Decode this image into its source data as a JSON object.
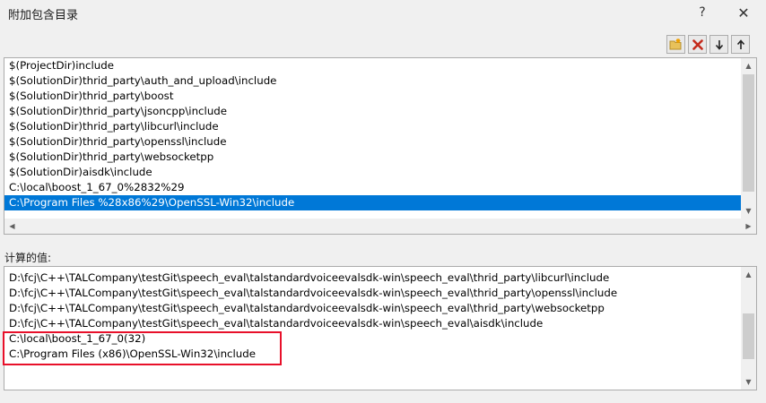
{
  "dialog": {
    "title": "附加包含目录",
    "help_symbol": "?",
    "close_symbol": "✕"
  },
  "toolbar": {
    "new_line_icon": "folder-new-icon",
    "delete_icon": "delete-icon",
    "move_down_icon": "arrow-down-icon",
    "move_up_icon": "arrow-up-icon",
    "delete_color": "#c42b1c"
  },
  "directories": {
    "items": [
      "$(ProjectDir)include",
      "$(SolutionDir)thrid_party\\auth_and_upload\\include",
      "$(SolutionDir)thrid_party\\boost",
      "$(SolutionDir)thrid_party\\jsoncpp\\include",
      "$(SolutionDir)thrid_party\\libcurl\\include",
      "$(SolutionDir)thrid_party\\openssl\\include",
      "$(SolutionDir)thrid_party\\websocketpp",
      "$(SolutionDir)aisdk\\include",
      "C:\\local\\boost_1_67_0%2832%29",
      "C:\\Program Files %28x86%29\\OpenSSL-Win32\\include"
    ],
    "selected_index": 9,
    "selection_color": "#0078d7"
  },
  "evaluated": {
    "label": "计算的值:",
    "items": [
      "D:\\fcj\\C++\\TALCompany\\testGit\\speech_eval\\talstandardvoiceevalsdk-win\\speech_eval\\thrid_party\\libcurl\\include",
      "D:\\fcj\\C++\\TALCompany\\testGit\\speech_eval\\talstandardvoiceevalsdk-win\\speech_eval\\thrid_party\\openssl\\include",
      "D:\\fcj\\C++\\TALCompany\\testGit\\speech_eval\\talstandardvoiceevalsdk-win\\speech_eval\\thrid_party\\websocketpp",
      "D:\\fcj\\C++\\TALCompany\\testGit\\speech_eval\\talstandardvoiceevalsdk-win\\speech_eval\\aisdk\\include",
      "C:\\local\\boost_1_67_0(32)",
      "C:\\Program Files (x86)\\OpenSSL-Win32\\include"
    ],
    "highlight_color": "#e8102a"
  }
}
